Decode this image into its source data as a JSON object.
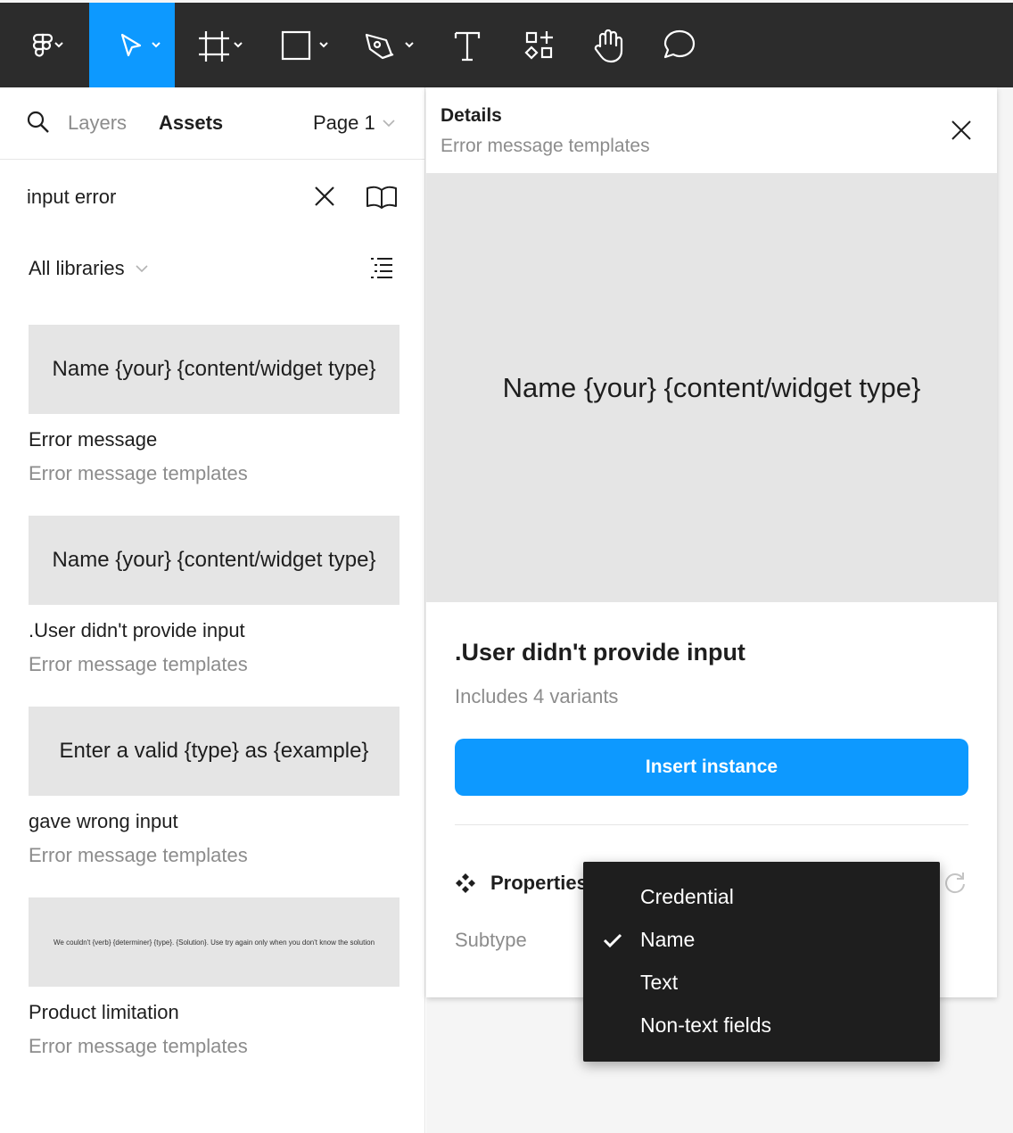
{
  "toolbar": {
    "tools": [
      {
        "icon": "figma-menu-icon",
        "has_dropdown": true
      },
      {
        "icon": "move-tool-icon",
        "has_dropdown": true,
        "active": true
      },
      {
        "icon": "frame-tool-icon",
        "has_dropdown": true
      },
      {
        "icon": "shape-tool-icon",
        "has_dropdown": true
      },
      {
        "icon": "pen-tool-icon",
        "has_dropdown": true
      },
      {
        "icon": "text-tool-icon",
        "has_dropdown": false
      },
      {
        "icon": "resources-icon",
        "has_dropdown": false
      },
      {
        "icon": "hand-tool-icon",
        "has_dropdown": false
      },
      {
        "icon": "comment-tool-icon",
        "has_dropdown": false
      }
    ],
    "accent": "#0d99ff",
    "background": "#2c2c2c"
  },
  "left_panel": {
    "tabs": {
      "layers": "Layers",
      "assets": "Assets",
      "page": "Page 1"
    },
    "search": {
      "value": "input error"
    },
    "library_filter": "All libraries",
    "assets": [
      {
        "thumbnail_text": "Name {your} {content/widget type}",
        "name": "Error message",
        "library": "Error message templates"
      },
      {
        "thumbnail_text": "Name {your} {content/widget type}",
        "name": ".User didn't provide input",
        "library": "Error message templates"
      },
      {
        "thumbnail_text": "Enter a valid {type} as {example}",
        "name": "gave wrong input",
        "library": "Error message templates"
      },
      {
        "thumbnail_text": "We couldn't {verb} {determiner} {type}. {Solution}. Use try again only when you don't know the solution",
        "name": "Product limitation",
        "library": "Error message templates"
      }
    ]
  },
  "details": {
    "title": "Details",
    "subtitle": "Error message templates",
    "preview_text": "Name {your} {content/widget type}",
    "component_name": ".User didn't provide input",
    "variants_text": "Includes 4 variants",
    "insert_button": "Insert instance",
    "properties_label": "Properties",
    "subtype_label": "Subtype"
  },
  "subtype_dropdown": {
    "options": [
      "Credential",
      "Name",
      "Text",
      "Non-text fields"
    ],
    "selected": "Name"
  }
}
